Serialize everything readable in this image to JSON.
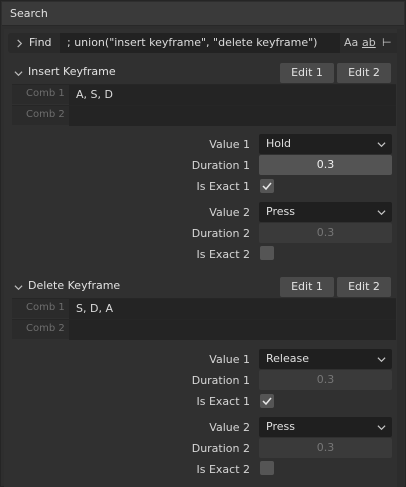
{
  "header": {
    "title": "Search"
  },
  "find": {
    "label": "Find",
    "query": "; union(\"insert keyframe\", \"delete keyframe\")",
    "opt_case": "Aa",
    "opt_word": "ab",
    "opt_regex": "⊢"
  },
  "sections": [
    {
      "title": "Insert Keyframe",
      "edit1": "Edit 1",
      "edit2": "Edit 2",
      "comb1_label": "Comb 1",
      "comb1_value": "A, S, D",
      "comb2_label": "Comb 2",
      "comb2_value": "",
      "value1_label": "Value 1",
      "value1": "Hold",
      "duration1_label": "Duration 1",
      "duration1": "0.3",
      "exact1_label": "Is Exact 1",
      "exact1_checked": true,
      "value2_label": "Value 2",
      "value2": "Press",
      "duration2_label": "Duration 2",
      "duration2": "0.3",
      "exact2_label": "Is Exact 2",
      "exact2_checked": false
    },
    {
      "title": "Delete Keyframe",
      "edit1": "Edit 1",
      "edit2": "Edit 2",
      "comb1_label": "Comb 1",
      "comb1_value": "S, D, A",
      "comb2_label": "Comb 2",
      "comb2_value": "",
      "value1_label": "Value 1",
      "value1": "Release",
      "duration1_label": "Duration 1",
      "duration1": "0.3",
      "exact1_label": "Is Exact 1",
      "exact1_checked": true,
      "value2_label": "Value 2",
      "value2": "Press",
      "duration2_label": "Duration 2",
      "duration2": "0.3",
      "exact2_label": "Is Exact 2",
      "exact2_checked": false
    }
  ]
}
